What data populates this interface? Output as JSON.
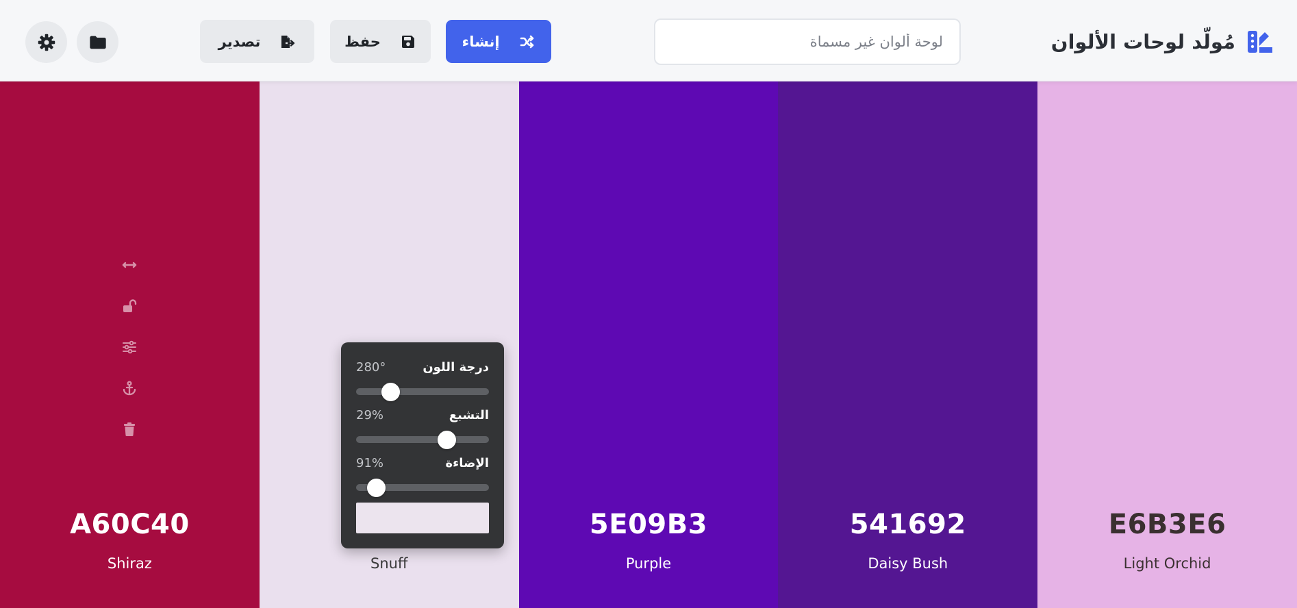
{
  "header": {
    "title": "مُولّد لوحات الألوان",
    "logo_icon": "palette-swatch-icon",
    "accent_color": "#4263eb",
    "palette_name": {
      "value": "",
      "placeholder": "لوحة ألوان غير مسماة"
    },
    "buttons": {
      "generate": {
        "label": "إنشاء",
        "icon": "shuffle-icon"
      },
      "save": {
        "label": "حفظ",
        "icon": "floppy-disk-icon"
      },
      "export": {
        "label": "تصدير",
        "icon": "file-export-icon"
      },
      "folder": {
        "icon": "folder-icon"
      },
      "settings": {
        "icon": "gear-icon"
      }
    }
  },
  "palette": {
    "colors": [
      {
        "hex": "A60C40",
        "name": "Shiraz",
        "bg": "#A60C40",
        "text_color": "#ffffff"
      },
      {
        "hex": "",
        "name": "Snuff",
        "bg": "#EAE0EE",
        "text_color": "#3a3a3a"
      },
      {
        "hex": "5E09B3",
        "name": "Purple",
        "bg": "#5E09B3",
        "text_color": "#ffffff"
      },
      {
        "hex": "541692",
        "name": "Daisy Bush",
        "bg": "#541692",
        "text_color": "#ffffff"
      },
      {
        "hex": "E6B3E6",
        "name": "Light Orchid",
        "bg": "#E6B3E6",
        "text_color": "#3a3030"
      }
    ],
    "swatch_tools": [
      {
        "name": "drag",
        "icon": "drag-arrows-icon"
      },
      {
        "name": "lock",
        "icon": "unlock-icon"
      },
      {
        "name": "adjust",
        "icon": "sliders-icon"
      },
      {
        "name": "anchor",
        "icon": "anchor-icon"
      },
      {
        "name": "delete",
        "icon": "trash-icon"
      }
    ]
  },
  "adjust_panel": {
    "preview_color": "#ECE4EE",
    "sliders": [
      {
        "label": "درجة اللون",
        "value_text": "280°",
        "fraction": 0.26
      },
      {
        "label": "التشبع",
        "value_text": "29%",
        "fraction": 0.68
      },
      {
        "label": "الإضاءة",
        "value_text": "91%",
        "fraction": 0.15
      }
    ]
  }
}
